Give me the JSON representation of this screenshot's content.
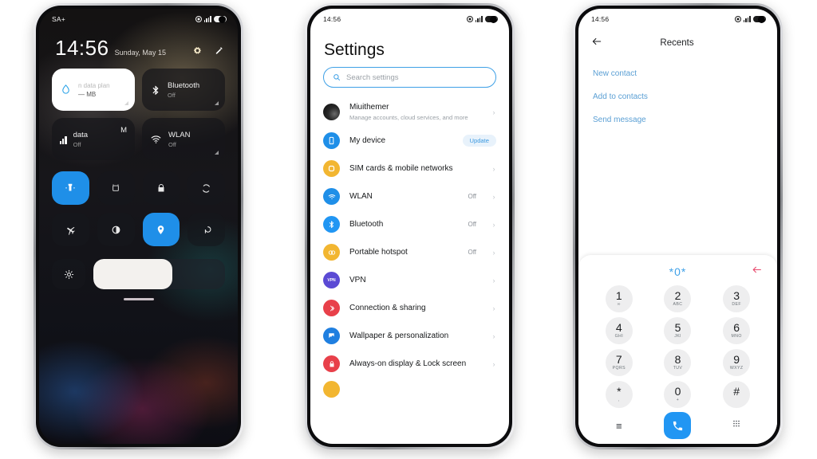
{
  "phone1": {
    "statusbar": {
      "carrier": "SA+",
      "icons": [
        "location-icon",
        "signal-icon",
        "battery-icon"
      ]
    },
    "lockscreen": {
      "time": "14:56",
      "date": "Sunday, May 15",
      "actions": [
        {
          "name": "settings-gear-icon"
        },
        {
          "name": "edit-pencil-icon"
        }
      ]
    },
    "big_tiles": [
      {
        "icon": "data-drop-icon",
        "title": "n data plan",
        "value": "— MB",
        "style": "light"
      },
      {
        "icon": "bluetooth-icon",
        "title": "Bluetooth",
        "value": "Off",
        "style": "dark"
      },
      {
        "icon": "signal-bars-icon",
        "title": "data",
        "extra": "M",
        "value": "Off",
        "style": "dark"
      },
      {
        "icon": "wlan-icon",
        "title": "WLAN",
        "value": "Off",
        "style": "dark"
      }
    ],
    "toggles": [
      {
        "name": "flashlight-toggle",
        "icon": "flashlight-icon",
        "active": true
      },
      {
        "name": "alarm-toggle",
        "icon": "alarm-icon",
        "active": false
      },
      {
        "name": "lock-toggle",
        "icon": "lock-icon",
        "active": false
      },
      {
        "name": "sync-toggle",
        "icon": "sync-icon",
        "active": false
      },
      {
        "name": "airplane-toggle",
        "icon": "airplane-icon",
        "active": false
      },
      {
        "name": "dark-mode-toggle",
        "icon": "dark-mode-icon",
        "active": false
      },
      {
        "name": "location-toggle",
        "icon": "location-pin-icon",
        "active": true
      },
      {
        "name": "cast-toggle",
        "icon": "screencast-icon",
        "active": false
      }
    ],
    "brightness": {
      "icon": "brightness-icon",
      "percent": 60
    },
    "accent": "#1f8fe8"
  },
  "phone2": {
    "statusbar": {
      "time": "14:56"
    },
    "title": "Settings",
    "search": {
      "placeholder": "Search settings",
      "icon": "search-icon"
    },
    "items": [
      {
        "icon": "account-avatar",
        "label": "Miuithemer",
        "desc": "Manage accounts, cloud services, and more",
        "value": "",
        "badge": "",
        "color": "#1c1c1c"
      },
      {
        "icon": "my-device-icon",
        "label": "My device",
        "desc": "",
        "value": "",
        "badge": "Update",
        "color": "#1f8fe8"
      },
      {
        "icon": "sim-cards-icon",
        "label": "SIM cards & mobile networks",
        "desc": "",
        "value": "",
        "badge": "",
        "color": "#f2b631"
      },
      {
        "icon": "wlan-icon",
        "label": "WLAN",
        "desc": "",
        "value": "Off",
        "badge": "",
        "color": "#1f8fe8"
      },
      {
        "icon": "bluetooth-icon",
        "label": "Bluetooth",
        "desc": "",
        "value": "Off",
        "badge": "",
        "color": "#2196f3"
      },
      {
        "icon": "hotspot-icon",
        "label": "Portable hotspot",
        "desc": "",
        "value": "Off",
        "badge": "",
        "color": "#f2b631"
      },
      {
        "icon": "vpn-icon",
        "label": "VPN",
        "desc": "",
        "value": "",
        "badge": "",
        "color": "#5b4ad4"
      },
      {
        "icon": "connection-sharing-icon",
        "label": "Connection & sharing",
        "desc": "",
        "value": "",
        "badge": "",
        "color": "#e8404a"
      },
      {
        "icon": "wallpaper-icon",
        "label": "Wallpaper & personalization",
        "desc": "",
        "value": "",
        "badge": "",
        "color": "#1f7fe0"
      },
      {
        "icon": "lock-screen-icon",
        "label": "Always-on display & Lock screen",
        "desc": "",
        "value": "",
        "badge": "",
        "color": "#e8404a"
      }
    ],
    "chevron": "›"
  },
  "phone3": {
    "statusbar": {
      "time": "14:56"
    },
    "back_icon": "back-arrow-icon",
    "title": "Recents",
    "links": [
      "New contact",
      "Add to contacts",
      "Send message"
    ],
    "dialer": {
      "number": "*0*",
      "backspace_icon": "backspace-arrow-icon",
      "backspace_color": "#e8486c",
      "number_color": "#3fa1e8",
      "keys": [
        {
          "num": "1",
          "sub": "∞"
        },
        {
          "num": "2",
          "sub": "ABC"
        },
        {
          "num": "3",
          "sub": "DEF"
        },
        {
          "num": "4",
          "sub": "GHI"
        },
        {
          "num": "5",
          "sub": "JKl"
        },
        {
          "num": "6",
          "sub": "MNO"
        },
        {
          "num": "7",
          "sub": "PQRS"
        },
        {
          "num": "8",
          "sub": "TUV"
        },
        {
          "num": "9",
          "sub": "WXYZ"
        },
        {
          "num": "*",
          "sub": ","
        },
        {
          "num": "0",
          "sub": "+"
        },
        {
          "num": "#",
          "sub": ""
        }
      ],
      "bottom": [
        {
          "name": "menu-icon",
          "glyph": "≡"
        },
        {
          "name": "call-button",
          "glyph": ""
        },
        {
          "name": "keypad-icon",
          "glyph": ""
        }
      ]
    }
  }
}
